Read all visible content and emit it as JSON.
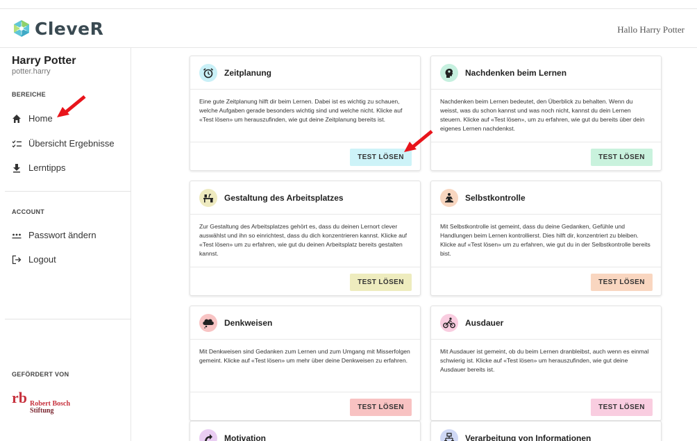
{
  "header": {
    "brand": "CleveR",
    "greeting": "Hallo Harry Potter"
  },
  "sidebar": {
    "user_name": "Harry Potter",
    "user_login": "potter.harry",
    "section_areas": "BEREICHE",
    "areas": [
      {
        "label": "Home",
        "icon": "home-icon"
      },
      {
        "label": "Übersicht Ergebnisse",
        "icon": "checklist-icon"
      },
      {
        "label": "Lerntipps",
        "icon": "download-icon"
      }
    ],
    "section_account": "ACCOUNT",
    "account": [
      {
        "label": "Passwort ändern",
        "icon": "password-icon"
      },
      {
        "label": "Logout",
        "icon": "logout-icon"
      }
    ],
    "sponsor_label": "GEFÖRDERT VON",
    "sponsor_mark": "rb",
    "sponsor_line1": "Robert Bosch",
    "sponsor_line2": "Stiftung"
  },
  "cards": [
    {
      "title": "Zeitplanung",
      "icon": "alarm-clock-icon",
      "icon_bg": "#c9f0f7",
      "btn_bg": "#cdf3f8",
      "text": "Eine gute Zeitplanung hilft dir beim Lernen. Dabei ist es wichtig zu schauen, welche Aufgaben gerade besonders wichtig sind und welche nicht. Klicke auf «Test lösen» um herauszufinden, wie gut deine Zeitplanung bereits ist.",
      "button": "TEST LÖSEN"
    },
    {
      "title": "Nachdenken beim Lernen",
      "icon": "thinking-head-icon",
      "icon_bg": "#c6f0df",
      "btn_bg": "#c9f2dd",
      "text": "Nachdenken beim Lernen bedeutet, den Überblick zu behalten. Wenn du weisst, was du schon kannst und was noch nicht, kannst du dein Lernen steuern. Klicke auf «Test lösen», um zu erfahren, wie gut du bereits über dein eigenes Lernen nachdenkst.",
      "button": "TEST LÖSEN"
    },
    {
      "title": "Gestaltung des Arbeitsplatzes",
      "icon": "desk-icon",
      "icon_bg": "#eeeabf",
      "btn_bg": "#eeecbe",
      "text": "Zur Gestaltung des Arbeitsplatzes gehört es, dass du deinen Lernort clever auswählst und ihn so einrichtest, dass du dich konzentrieren kannst. Klicke auf «Test lösen» um zu erfahren, wie gut du deinen Arbeitsplatz bereits gestalten kannst.",
      "button": "TEST LÖSEN"
    },
    {
      "title": "Selbstkontrolle",
      "icon": "meditation-icon",
      "icon_bg": "#f8d6c0",
      "btn_bg": "#f9d6c0",
      "text": "Mit Selbstkontrolle ist gemeint, dass du deine Gedanken, Gefühle und Handlungen beim Lernen kontrollierst. Dies hilft dir, konzentriert zu bleiben. Klicke auf «Test lösen» um zu erfahren, wie gut du in der Selbstkontrolle bereits bist.",
      "button": "TEST LÖSEN"
    },
    {
      "title": "Denkweisen",
      "icon": "thought-cloud-icon",
      "icon_bg": "#f8c4c4",
      "btn_bg": "#f8c2c2",
      "text": "Mit Denkweisen sind Gedanken zum Lernen und zum Umgang mit Misserfolgen gemeint. Klicke auf «Test lösen» um mehr über deine Denkweisen zu erfahren.",
      "button": "TEST LÖSEN"
    },
    {
      "title": "Ausdauer",
      "icon": "cyclist-icon",
      "icon_bg": "#f9cde0",
      "btn_bg": "#f9cde0",
      "text": "Mit Ausdauer ist gemeint, ob du beim Lernen dranbleibst, auch wenn es einmal schwierig ist. Klicke auf «Test lösen» um herauszufinden, wie gut deine Ausdauer bereits ist.",
      "button": "TEST LÖSEN"
    },
    {
      "title": "Motivation",
      "icon": "motivation-icon",
      "icon_bg": "#e9cdf2"
    },
    {
      "title": "Verarbeitung von Informationen",
      "icon": "processing-icon",
      "icon_bg": "#cfd8f5"
    }
  ]
}
